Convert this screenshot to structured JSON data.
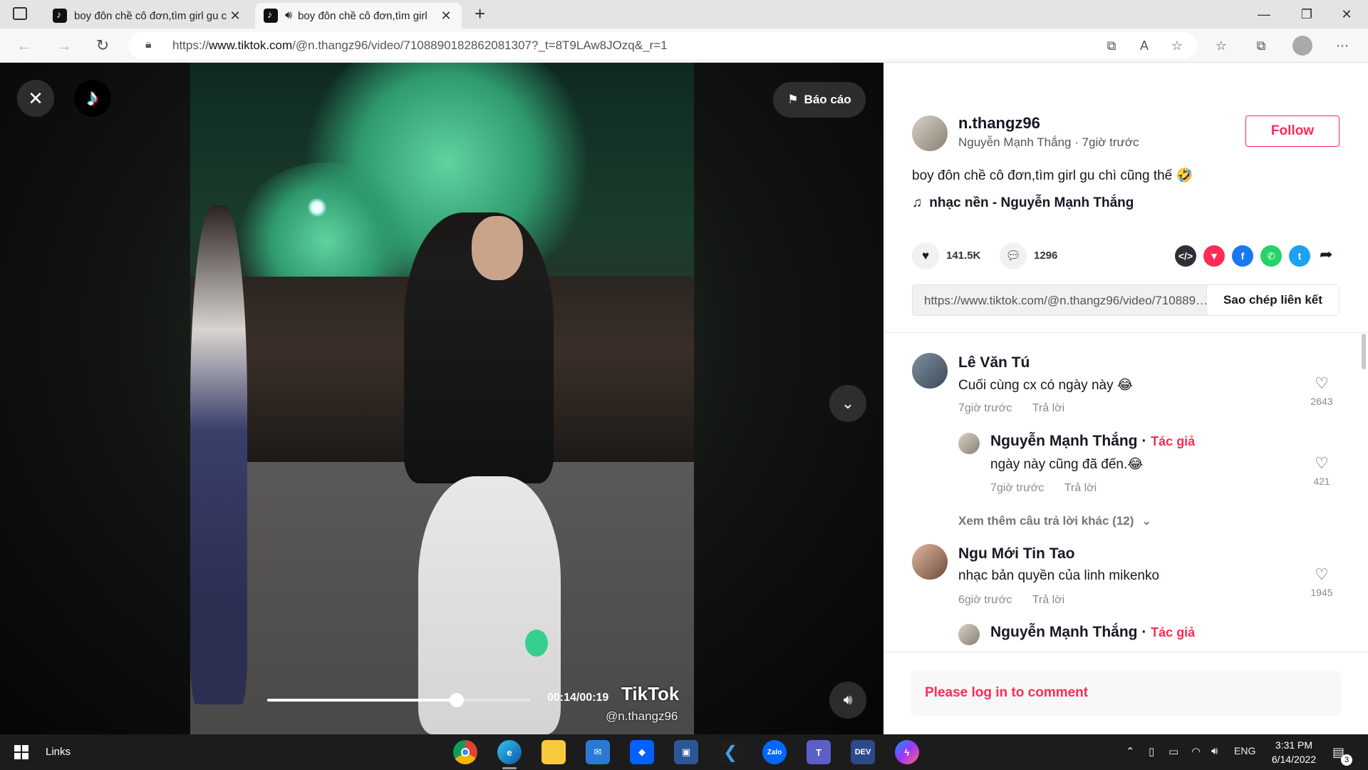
{
  "browser": {
    "tabs": [
      {
        "title": "boy đôn chề cô đơn,tìm girl gu c"
      },
      {
        "title": "boy đôn chề cô đơn,tìm girl"
      }
    ],
    "url_prefix": "https://",
    "url_host": "www.tiktok.com",
    "url_path": "/@n.thangz96/video/7108890182862081307?_t=8T9LAw8JOzq&_r=1"
  },
  "video": {
    "report_label": "Báo cáo",
    "timecode": "00:14/00:19",
    "progress_fraction": 0.72,
    "watermark": "TikTok",
    "watermark_user": "@n.thangz96"
  },
  "post": {
    "username": "n.thangz96",
    "display_name": "Nguyễn Mạnh Thắng",
    "separator": " · ",
    "time": "7giờ trước",
    "follow_label": "Follow",
    "description": "boy đôn chề cô đơn,tìm girl gu chì cũng thế 🤣",
    "music": "nhạc nền - Nguyễn Mạnh Thắng",
    "likes": "141.5K",
    "comments_count": "1296",
    "link_url": "https://www.tiktok.com/@n.thangz96/video/7108890182862081307?_t=8T9LAw8JOzq&_r=1",
    "copy_label": "Sao chép liên kết",
    "share_colors": {
      "embed": "#2f3036",
      "pinterest": "#fe2c55",
      "facebook": "#1877f2",
      "whatsapp": "#25d366",
      "twitter": "#1da1f2"
    }
  },
  "comments": [
    {
      "name": "Lê Văn Tú",
      "text": "Cuối cùng cx có ngày này 😂",
      "time": "7giờ trước",
      "reply": "Trả lời",
      "likes": "2643"
    },
    {
      "name": "Nguyễn Mạnh Thắng",
      "author_sep": " · ",
      "author_tag": "Tác giả",
      "text": "ngày này cũng đã đến.😂",
      "time": "7giờ trước",
      "reply": "Trả lời",
      "likes": "421"
    },
    {
      "more": "Xem thêm câu trả lời khác (12)"
    },
    {
      "name": "Ngu Mới Tin Tao",
      "text": "nhạc bản quyền của linh mikenko",
      "time": "6giờ trước",
      "reply": "Trả lời",
      "likes": "1945"
    },
    {
      "name": "Nguyễn Mạnh Thắng",
      "author_sep": " · ",
      "author_tag": "Tác giả"
    }
  ],
  "login_prompt": "Please log in to comment",
  "taskbar": {
    "links_label": "Links",
    "lang": "ENG",
    "time": "3:31 PM",
    "date": "6/14/2022",
    "notif_count": "3",
    "zalo": "Zalo",
    "dev": "DEV"
  }
}
